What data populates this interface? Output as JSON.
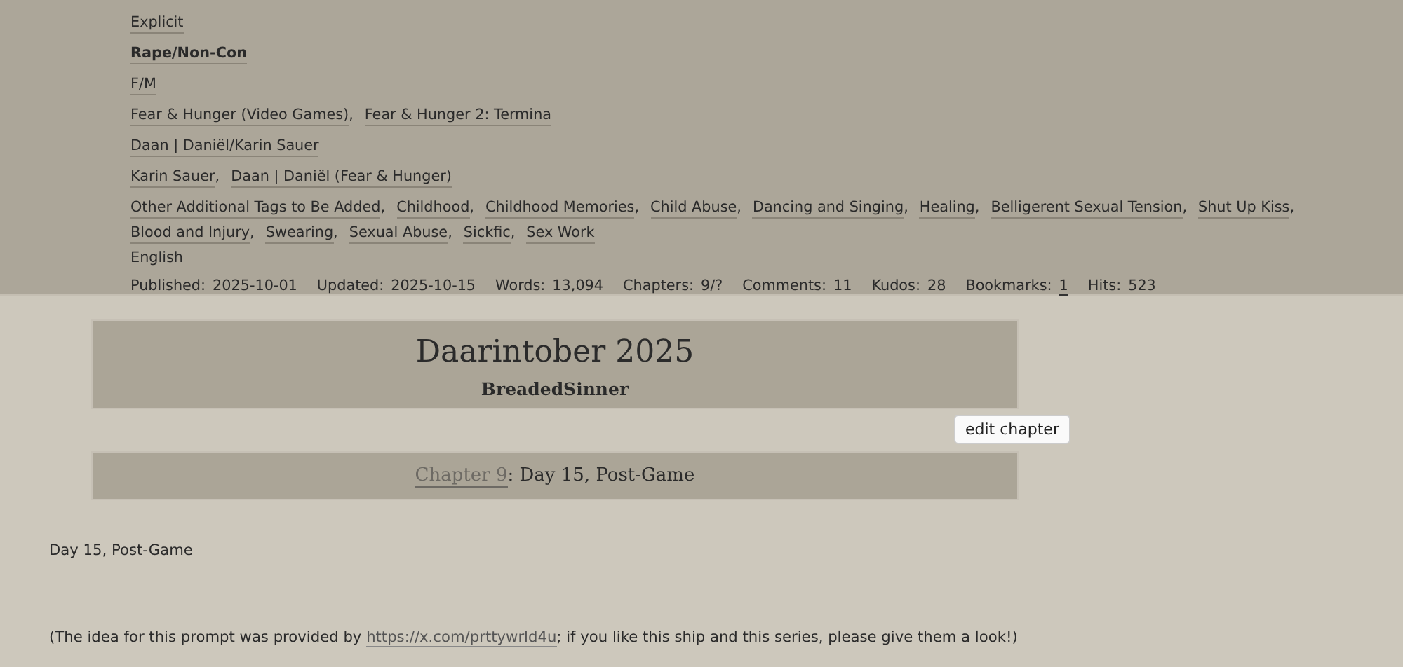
{
  "tag_rows": [
    {
      "bold": false,
      "tags": [
        "Explicit"
      ]
    },
    {
      "bold": true,
      "tags": [
        "Rape/Non-Con"
      ]
    },
    {
      "bold": false,
      "tags": [
        "F/M"
      ]
    },
    {
      "bold": false,
      "tags": [
        "Fear & Hunger (Video Games)",
        "Fear & Hunger 2: Termina"
      ]
    },
    {
      "bold": false,
      "tags": [
        "Daan | Daniël/Karin Sauer"
      ]
    },
    {
      "bold": false,
      "tags": [
        "Karin Sauer",
        "Daan | Daniël (Fear & Hunger)"
      ]
    },
    {
      "bold": false,
      "tags": [
        "Other Additional Tags to Be Added",
        "Childhood",
        "Childhood Memories",
        "Child Abuse",
        "Dancing and Singing",
        "Healing",
        "Belligerent Sexual Tension",
        "Shut Up Kiss",
        "Blood and Injury",
        "Swearing",
        "Sexual Abuse",
        "Sickfic",
        "Sex Work"
      ]
    }
  ],
  "separator": ",",
  "language": "English",
  "stats": [
    {
      "label": "Published:",
      "value": "2025-10-01",
      "link": false
    },
    {
      "label": "Updated:",
      "value": "2025-10-15",
      "link": false
    },
    {
      "label": "Words:",
      "value": "13,094",
      "link": false
    },
    {
      "label": "Chapters:",
      "value": "9/?",
      "link": false
    },
    {
      "label": "Comments:",
      "value": "11",
      "link": false
    },
    {
      "label": "Kudos:",
      "value": "28",
      "link": false
    },
    {
      "label": "Bookmarks:",
      "value": "1",
      "link": true
    },
    {
      "label": "Hits:",
      "value": "523",
      "link": false
    }
  ],
  "work": {
    "title": "Daarintober 2025",
    "author": "BreadedSinner"
  },
  "edit_button": "edit chapter",
  "chapter": {
    "link": "Chapter 9",
    "title": ": Day 15, Post-Game"
  },
  "body": [
    {
      "kind": "text",
      "text": "Day 15, Post-Game"
    },
    {
      "kind": "link_paragraph",
      "before": "(The idea for this prompt was provided by ",
      "link": "https://x.com/prttywrld4u",
      "after": "; if you like this ship and this series, please give them a look!)"
    }
  ]
}
